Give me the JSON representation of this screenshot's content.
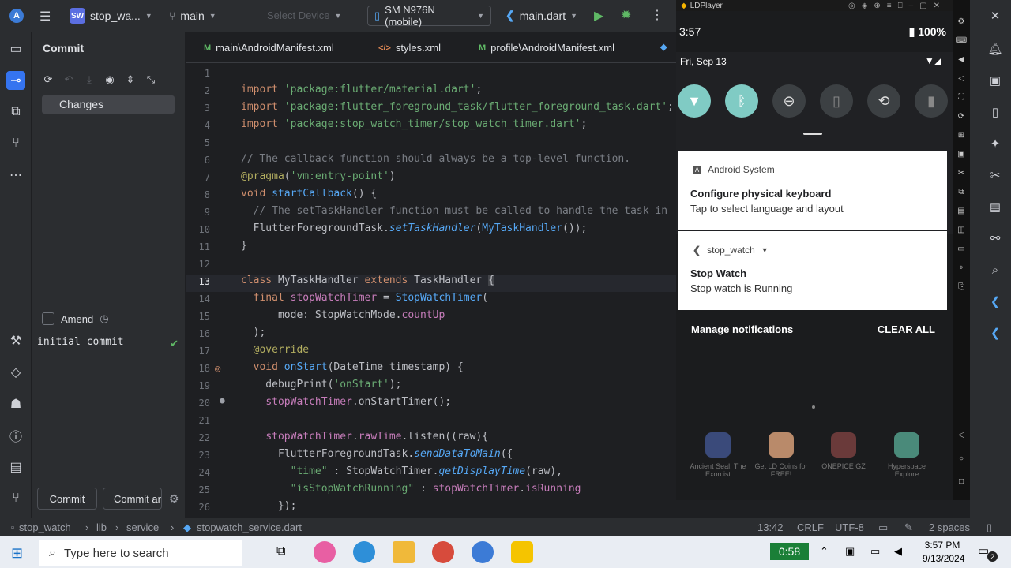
{
  "topbar": {
    "project_badge": "SW",
    "project_name": "stop_wa...",
    "branch": "main",
    "device_placeholder": "Select Device",
    "device_selected": "SM N976N (mobile)",
    "run_config": "main.dart"
  },
  "commit_panel": {
    "title": "Commit",
    "changes_label": "Changes",
    "amend_label": "Amend",
    "message": "initial commit",
    "commit_button": "Commit",
    "commit_and_push_button": "Commit ar"
  },
  "tabs": [
    {
      "label": "main\\AndroidManifest.xml"
    },
    {
      "label": "styles.xml"
    },
    {
      "label": "profile\\AndroidManifest.xml"
    }
  ],
  "editor": {
    "line_numbers": [
      "1",
      "2",
      "3",
      "4",
      "5",
      "6",
      "7",
      "8",
      "9",
      "10",
      "11",
      "12",
      "13",
      "14",
      "15",
      "16",
      "17",
      "18",
      "19",
      "20",
      "21",
      "22",
      "23",
      "24",
      "25",
      "26"
    ]
  },
  "emulator": {
    "window_title": "LDPlayer",
    "time": "3:57",
    "battery": "100%",
    "date": "Fri, Sep 13",
    "notifications": [
      {
        "app": "Android System",
        "title": "Configure physical keyboard",
        "text": "Tap to select language and layout"
      },
      {
        "app": "stop_watch",
        "title": "Stop Watch",
        "text": "Stop watch is Running"
      }
    ],
    "manage_label": "Manage notifications",
    "clear_all_label": "CLEAR ALL",
    "games": [
      {
        "name": "Ancient Seal: The Exorcist"
      },
      {
        "name": "Get LD Coins for FREE!"
      },
      {
        "name": "ONEPICE GZ"
      },
      {
        "name": "Hyperspace Explore"
      }
    ]
  },
  "statusbar": {
    "crumbs": [
      "stop_watch",
      "lib",
      "service",
      "stopwatch_service.dart"
    ],
    "position": "13:42",
    "line_ending": "CRLF",
    "encoding": "UTF-8",
    "indent": "2 spaces"
  },
  "taskbar": {
    "search_placeholder": "Type here to search",
    "timer": "0:58",
    "clock_time": "3:57 PM",
    "clock_date": "9/13/2024",
    "notification_count": "2"
  }
}
